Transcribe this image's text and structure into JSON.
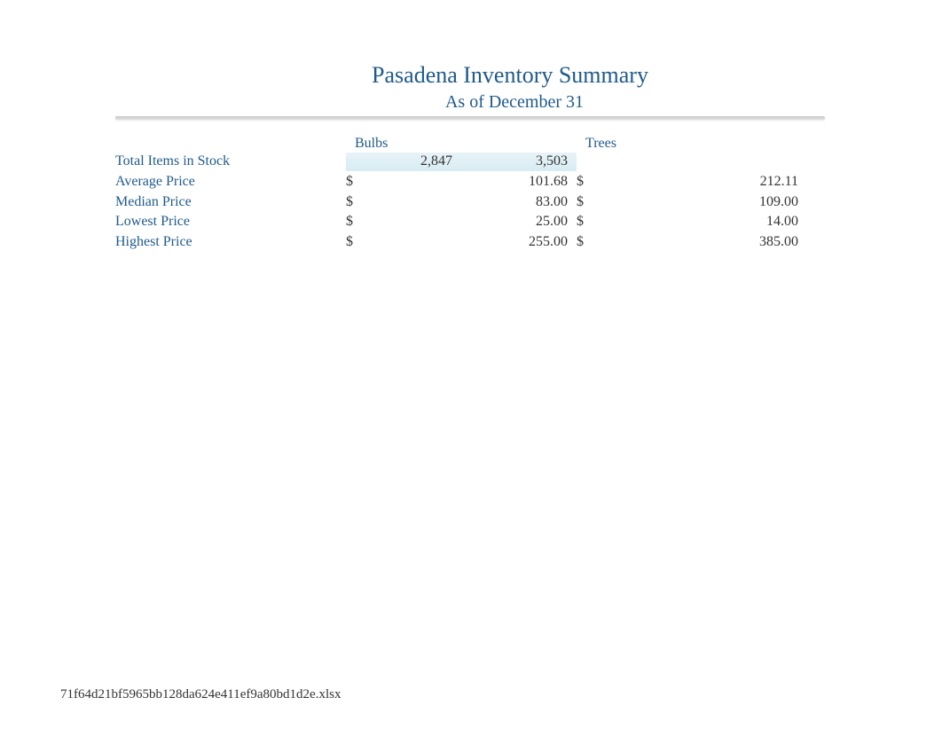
{
  "title": "Pasadena Inventory Summary",
  "subtitle": "As of December 31",
  "columns": {
    "bulbs": "Bulbs",
    "trees": "Trees"
  },
  "rows": {
    "total_items": {
      "label": "Total Items in Stock",
      "bulbs": "2,847",
      "trees": "3,503"
    },
    "average_price": {
      "label": "Average Price",
      "bulbs_currency": "$",
      "bulbs": "101.68",
      "trees_currency": "$",
      "trees": "212.11"
    },
    "median_price": {
      "label": "Median Price",
      "bulbs_currency": "$",
      "bulbs": "83.00",
      "trees_currency": "$",
      "trees": "109.00"
    },
    "lowest_price": {
      "label": "Lowest Price",
      "bulbs_currency": "$",
      "bulbs": "25.00",
      "trees_currency": "$",
      "trees": "14.00"
    },
    "highest_price": {
      "label": "Highest Price",
      "bulbs_currency": "$",
      "bulbs": "255.00",
      "trees_currency": "$",
      "trees": "385.00"
    }
  },
  "footer": "71f64d21bf5965bb128da624e411ef9a80bd1d2e.xlsx"
}
